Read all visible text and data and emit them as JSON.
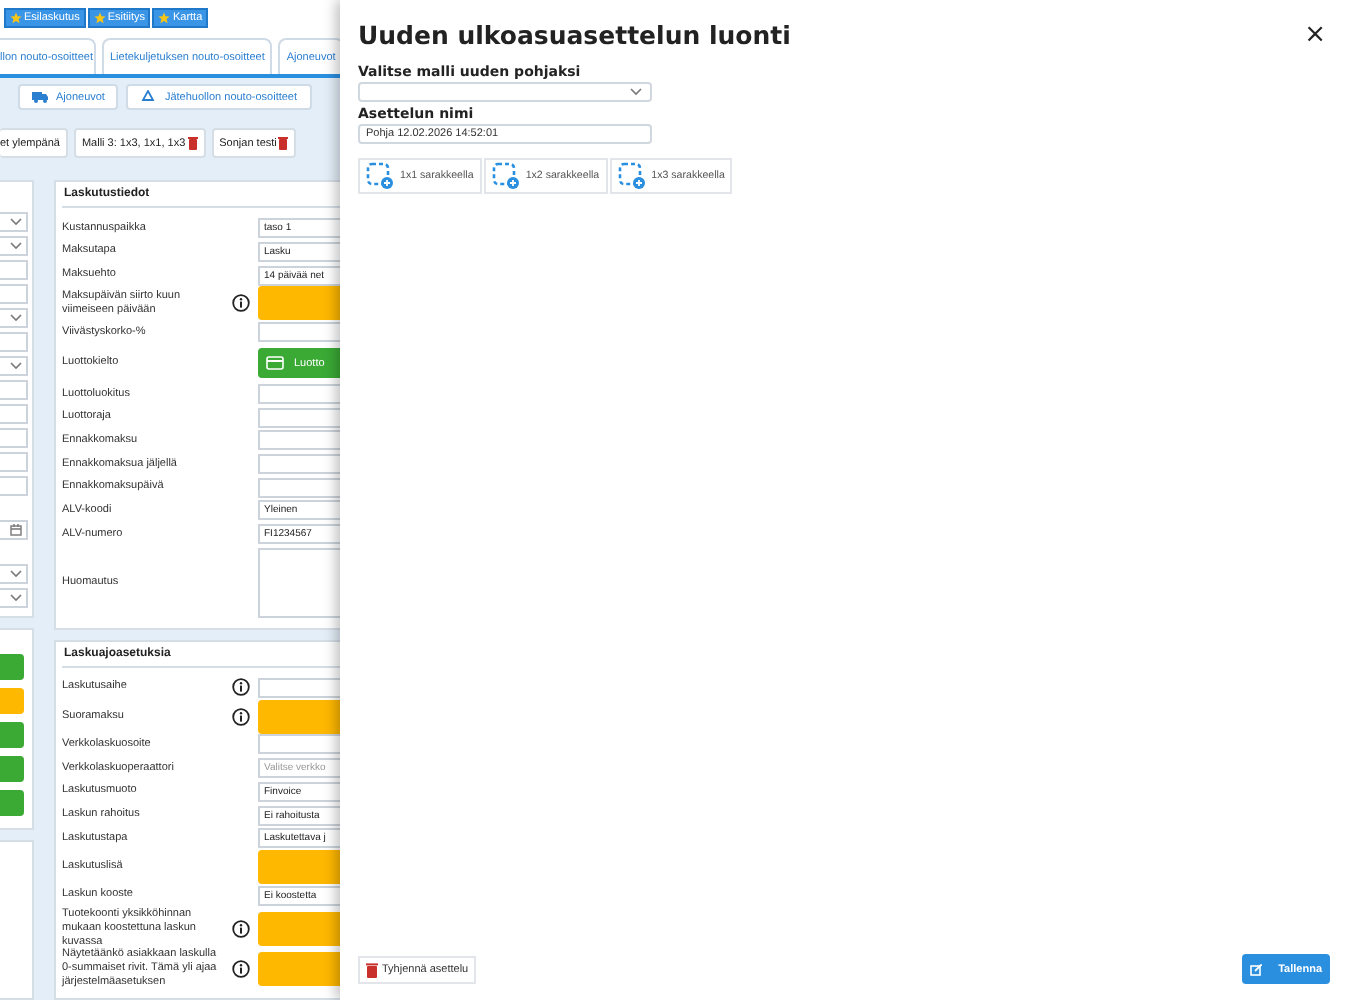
{
  "top_buttons": [
    {
      "label": "Esilaskutus"
    },
    {
      "label": "Esitiitys"
    },
    {
      "label": "Kartta"
    }
  ],
  "tabs": [
    {
      "label": "llon nouto-osoitteet",
      "selected": false
    },
    {
      "label": "Lietekuljetuksen nouto-osoitteet",
      "selected": false
    },
    {
      "label": "Ajoneuvot",
      "selected": false
    }
  ],
  "sub_buttons": [
    {
      "label": "Ajoneuvot"
    },
    {
      "label": "Jätehuollon nouto-osoitteet"
    }
  ],
  "layouts": [
    {
      "label": "et ylempänä",
      "deletable": false
    },
    {
      "label": "Malli 3: 1x3, 1x1, 1x3",
      "deletable": true
    },
    {
      "label": "Sonjan testi",
      "deletable": true
    }
  ],
  "left_fields": [
    {
      "kind": "select"
    },
    {
      "kind": "select"
    },
    {
      "kind": "input"
    },
    {
      "kind": "input"
    },
    {
      "kind": "select"
    },
    {
      "kind": "input"
    },
    {
      "kind": "select"
    },
    {
      "kind": "input"
    },
    {
      "kind": "input"
    },
    {
      "kind": "input"
    },
    {
      "kind": "input"
    },
    {
      "kind": "input"
    },
    {
      "kind": "gap"
    },
    {
      "kind": "date"
    },
    {
      "kind": "gap"
    },
    {
      "kind": "select"
    },
    {
      "kind": "select"
    }
  ],
  "left_buttons": [
    {
      "color": "#3aaa35"
    },
    {
      "color": "#ffb800"
    },
    {
      "color": "#3aaa35"
    },
    {
      "color": "#3aaa35"
    },
    {
      "color": "#3aaa35"
    }
  ],
  "sections": [
    {
      "title": "Laskutustiedot",
      "rows": [
        {
          "label": "Kustannuspaikka",
          "kind": "select",
          "value": "taso 1",
          "info": false
        },
        {
          "label": "Maksutapa",
          "kind": "select",
          "value": "Lasku",
          "info": false
        },
        {
          "label": "Maksuehto",
          "kind": "select",
          "value": "14 päivää net",
          "info": false
        },
        {
          "label": "Maksupäivän siirto kuun viimeiseen päivään",
          "kind": "toggle",
          "info": true
        },
        {
          "label": "Viivästyskorko-%",
          "kind": "input",
          "info": false
        },
        {
          "label": "Luottokielto",
          "kind": "credit",
          "value": "Luotto",
          "info": false
        },
        {
          "label": "Luottoluokitus",
          "kind": "input",
          "info": false
        },
        {
          "label": "Luottoraja",
          "kind": "input",
          "info": false
        },
        {
          "label": "Ennakkomaksu",
          "kind": "input",
          "info": false
        },
        {
          "label": "Ennakkomaksua jäljellä",
          "kind": "input",
          "info": false
        },
        {
          "label": "Ennakkomaksupäivä",
          "kind": "input",
          "info": false
        },
        {
          "label": "ALV-koodi",
          "kind": "select",
          "value": "Yleinen",
          "info": false
        },
        {
          "label": "ALV-numero",
          "kind": "input",
          "value": "FI1234567",
          "info": false
        },
        {
          "label": "Huomautus",
          "kind": "textarea",
          "info": false
        }
      ]
    },
    {
      "title": "Laskuajoasetuksia",
      "rows": [
        {
          "label": "Laskutusaihe",
          "kind": "input",
          "info": true
        },
        {
          "label": "Suoramaksu",
          "kind": "toggle",
          "info": true
        },
        {
          "label": "Verkkolaskuosoite",
          "kind": "input",
          "info": false
        },
        {
          "label": "Verkkolaskuoperaattori",
          "kind": "select",
          "placeholder": "Valitse verkko",
          "info": false
        },
        {
          "label": "Laskutusmuoto",
          "kind": "select",
          "value": "Finvoice",
          "info": false
        },
        {
          "label": "Laskun rahoitus",
          "kind": "select",
          "value": "Ei rahoitusta",
          "info": false
        },
        {
          "label": "Laskutustapa",
          "kind": "select",
          "value": "Laskutettava j",
          "info": false
        },
        {
          "label": "Laskutuslisä",
          "kind": "toggle",
          "info": false
        },
        {
          "label": "Laskun kooste",
          "kind": "select",
          "value": "Ei koostetta",
          "info": false
        },
        {
          "label": "Tuotekoonti yksikköhinnan mukaan koostettuna laskun kuvassa",
          "kind": "toggle",
          "info": true
        },
        {
          "label": "Näytetäänkö asiakkaan laskulla 0-summaiset rivit. Tämä yli ajaa järjestelmäasetuksen",
          "kind": "toggle",
          "info": true
        }
      ]
    }
  ],
  "drawer": {
    "title": "Uuden ulkoasuasettelun luonti",
    "close": "×",
    "template": {
      "label": "Valitse malli uuden pohjaksi"
    },
    "name": {
      "label": "Asettelun nimi",
      "value": "Pohja 12.02.2026 14:52:01"
    },
    "layout_buttons": [
      {
        "label": "1x1 sarakkeella"
      },
      {
        "label": "1x2 sarakkeella"
      },
      {
        "label": "1x3 sarakkeella"
      }
    ],
    "clear_button": "Tyhjennä asettelu",
    "save_button": "Tallenna"
  }
}
